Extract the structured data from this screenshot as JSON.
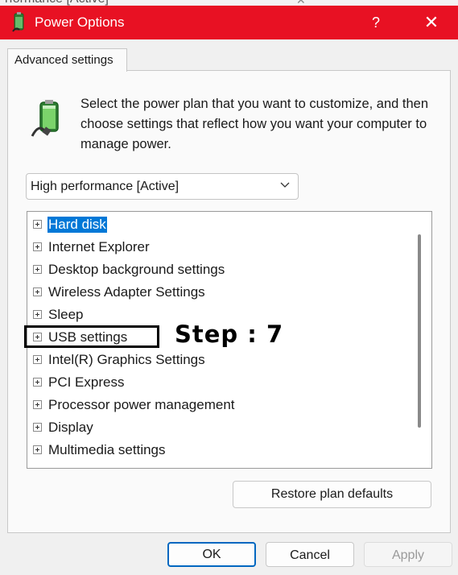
{
  "background_window": {
    "title_fragment": "rformance [Active]"
  },
  "window": {
    "title": "Power Options",
    "help_glyph": "?",
    "close_glyph": "✕",
    "accent_color": "#e81123"
  },
  "tabs": [
    {
      "label": "Advanced settings",
      "active": true
    }
  ],
  "intro_text": "Select the power plan that you want to customize, and then choose settings that reflect how you want your computer to manage power.",
  "plan_select": {
    "value": "High performance [Active]"
  },
  "settings_tree": {
    "items": [
      {
        "label": "Hard disk",
        "selected": true
      },
      {
        "label": "Internet Explorer"
      },
      {
        "label": "Desktop background settings"
      },
      {
        "label": "Wireless Adapter Settings"
      },
      {
        "label": "Sleep"
      },
      {
        "label": "USB settings"
      },
      {
        "label": "Intel(R) Graphics Settings"
      },
      {
        "label": "PCI Express"
      },
      {
        "label": "Processor power management"
      },
      {
        "label": "Display"
      },
      {
        "label": "Multimedia settings"
      }
    ]
  },
  "annotation": {
    "label": "Step : 7",
    "highlighted_item": "USB settings"
  },
  "buttons": {
    "restore": "Restore plan defaults",
    "ok": "OK",
    "cancel": "Cancel",
    "apply": "Apply"
  }
}
